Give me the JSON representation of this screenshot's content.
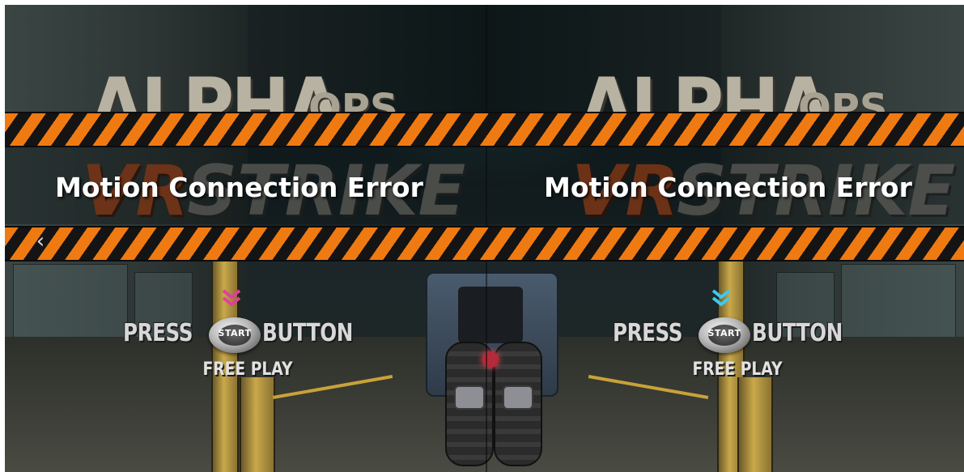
{
  "screen": {
    "title_logo": {
      "word_main": "ALPHA",
      "word_small": "OPS",
      "word_vr": "VR",
      "word_strike": "STRIKE"
    },
    "error_message": "Motion Connection Error",
    "players": [
      {
        "side": "left",
        "press_label": "PRESS",
        "start_label": "START",
        "button_label": "BUTTON",
        "mode_label": "FREE PLAY",
        "indicator_color": "#e0409a"
      },
      {
        "side": "right",
        "press_label": "PRESS",
        "start_label": "START",
        "button_label": "BUTTON",
        "mode_label": "FREE PLAY",
        "indicator_color": "#3ec8f0"
      }
    ],
    "nav": {
      "prev_icon": "chevron-left-icon",
      "prev_glyph": "‹"
    },
    "colors": {
      "hazard_orange": "#f07a12",
      "hazard_black": "#141414",
      "error_text": "#ffffff"
    }
  }
}
